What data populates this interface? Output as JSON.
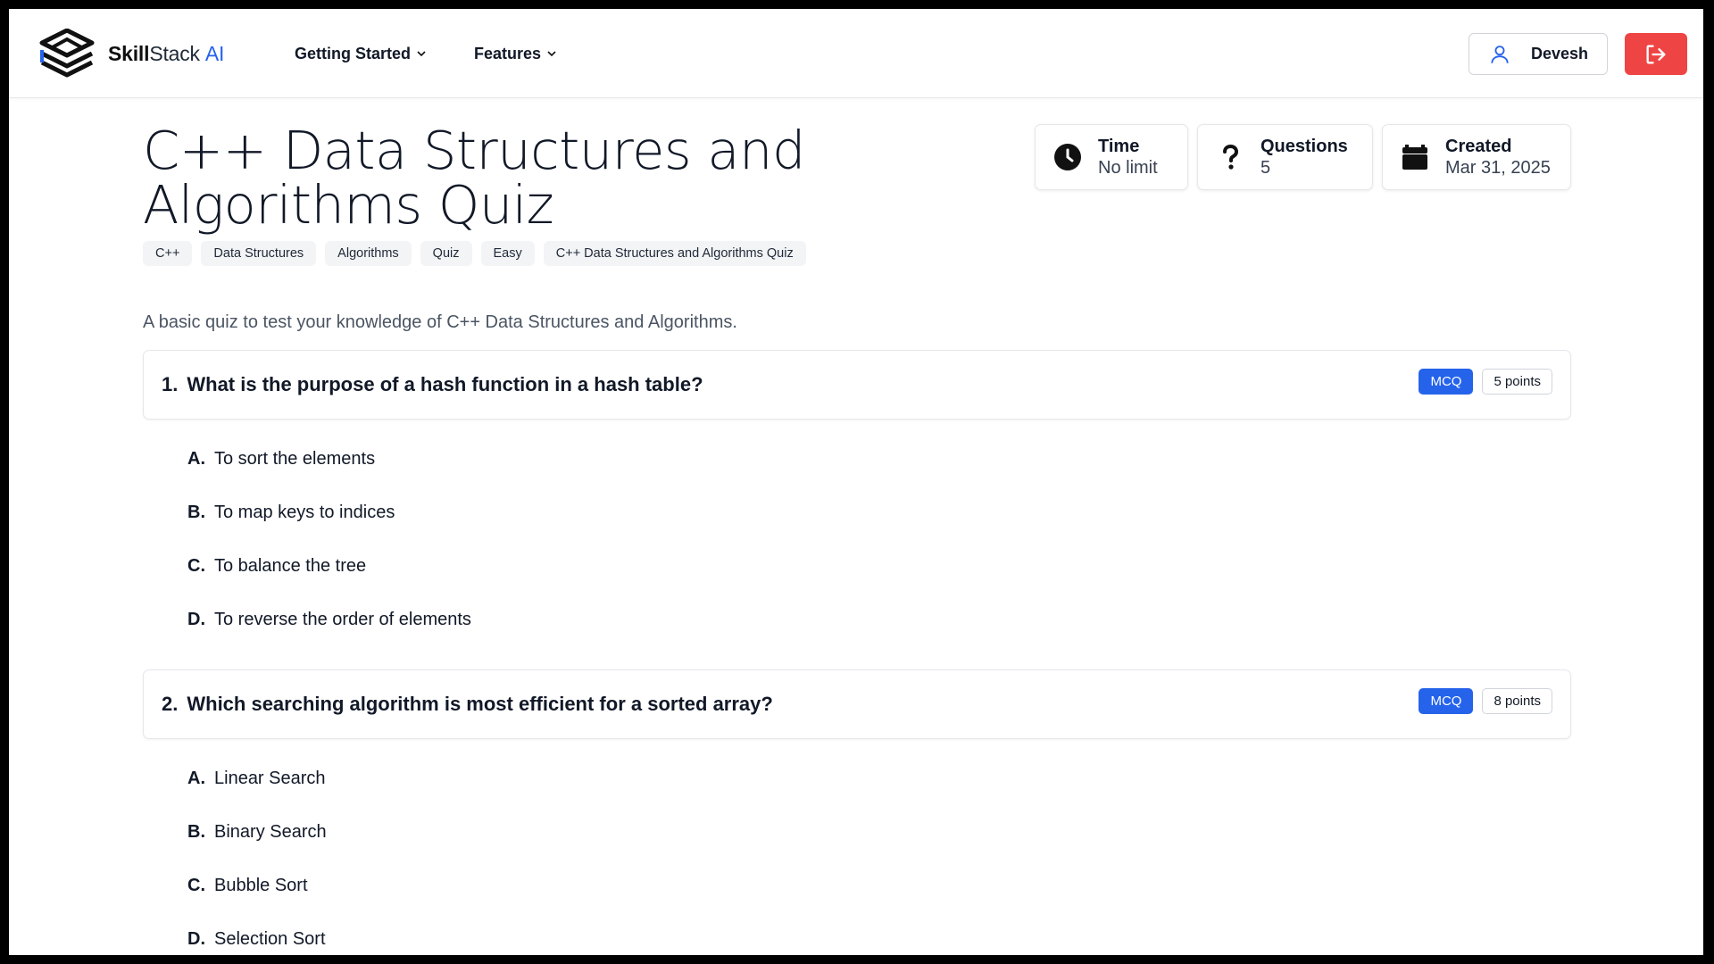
{
  "header": {
    "logo_bold": "Skill",
    "logo_regular": "Stack",
    "logo_accent": "AI",
    "nav": [
      {
        "label": "Getting Started"
      },
      {
        "label": "Features"
      }
    ],
    "user_name": "Devesh"
  },
  "quiz": {
    "title": "C++ Data Structures and Algorithms Quiz",
    "tags": [
      "C++",
      "Data Structures",
      "Algorithms",
      "Quiz",
      "Easy",
      "C++ Data Structures and Algorithms Quiz"
    ],
    "description": "A basic quiz to test your knowledge of C++ Data Structures and Algorithms.",
    "stats": [
      {
        "label": "Time",
        "value": "No limit",
        "icon": "clock-icon"
      },
      {
        "label": "Questions",
        "value": "5",
        "icon": "question-icon"
      },
      {
        "label": "Created",
        "value": "Mar 31, 2025",
        "icon": "calendar-icon"
      }
    ],
    "questions": [
      {
        "number": "1.",
        "text": "What is the purpose of a hash function in a hash table?",
        "type": "MCQ",
        "points": "5 points",
        "options": [
          {
            "letter": "A.",
            "text": "To sort the elements"
          },
          {
            "letter": "B.",
            "text": "To map keys to indices"
          },
          {
            "letter": "C.",
            "text": "To balance the tree"
          },
          {
            "letter": "D.",
            "text": "To reverse the order of elements"
          }
        ]
      },
      {
        "number": "2.",
        "text": "Which searching algorithm is most efficient for a sorted array?",
        "type": "MCQ",
        "points": "8 points",
        "options": [
          {
            "letter": "A.",
            "text": "Linear Search"
          },
          {
            "letter": "B.",
            "text": "Binary Search"
          },
          {
            "letter": "C.",
            "text": "Bubble Sort"
          },
          {
            "letter": "D.",
            "text": "Selection Sort"
          }
        ]
      }
    ]
  },
  "colors": {
    "accent": "#2563eb",
    "logout": "#ef4444"
  }
}
